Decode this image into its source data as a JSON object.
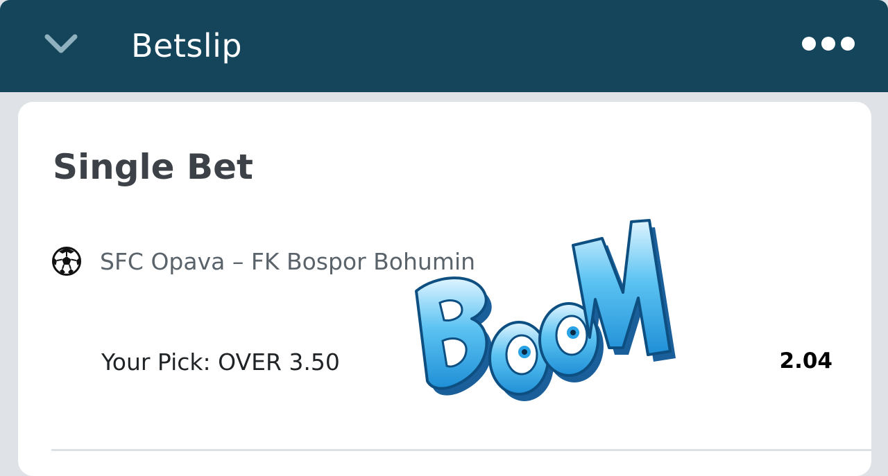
{
  "header": {
    "title": "Betslip",
    "collapse_icon": "chevron-down-icon",
    "more_icon": "more-dots-icon",
    "background_color": "#14455a"
  },
  "bet": {
    "section_title": "Single Bet",
    "sport_icon": "soccer-ball-icon",
    "match": "SFC Opava – FK Bospor Bohumin",
    "pick": "Your Pick: OVER 3.50",
    "odds": "2.04"
  },
  "sticker": {
    "text": "BOOM",
    "color": "#2aa3e6"
  }
}
